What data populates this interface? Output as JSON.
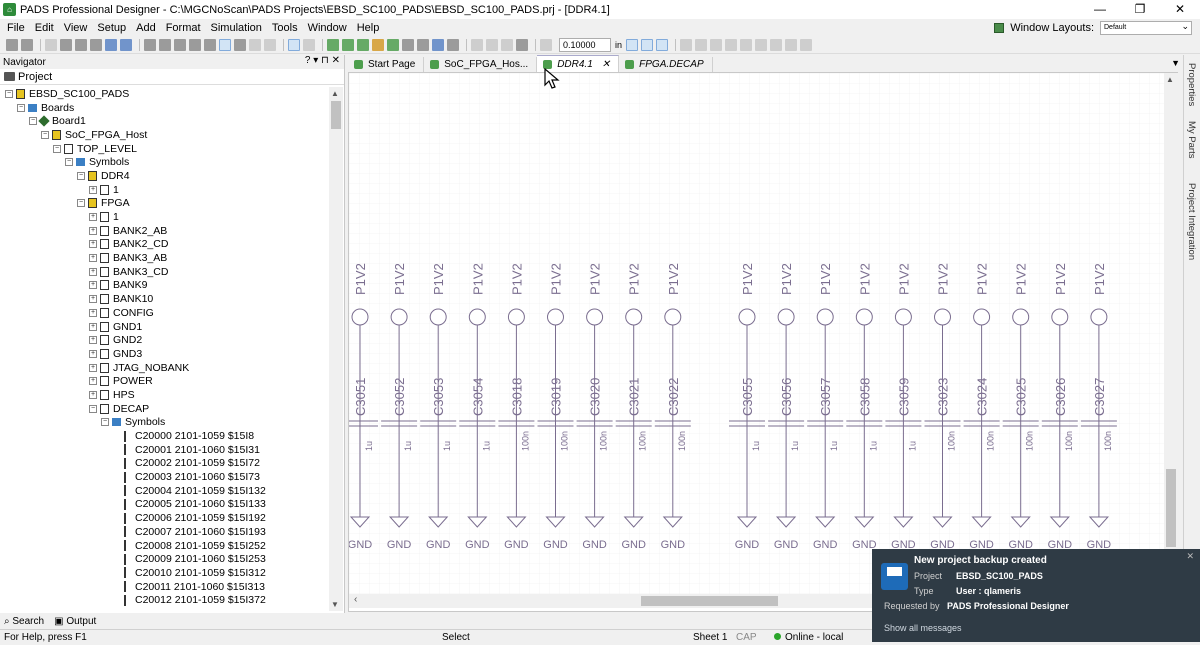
{
  "window": {
    "title": "PADS Professional Designer - C:\\MGCNoScan\\PADS Projects\\EBSD_SC100_PADS\\EBSD_SC100_PADS.prj - [DDR4.1]",
    "min": "—",
    "max": "❐",
    "close": "✕"
  },
  "menu": [
    "File",
    "Edit",
    "View",
    "Setup",
    "Add",
    "Format",
    "Simulation",
    "Tools",
    "Window",
    "Help"
  ],
  "window_layouts": {
    "label": "Window Layouts:",
    "value": "Default"
  },
  "toolbar": {
    "grid_value": "0.10000",
    "unit": "in"
  },
  "navigator": {
    "title": "Navigator",
    "controls": "? ▾ ⊓ ✕",
    "tab": "Project"
  },
  "tree": [
    {
      "label": "EBSD_SC100_PADS",
      "depth": 0,
      "exp": "−",
      "icon": "chip"
    },
    {
      "label": "Boards",
      "depth": 1,
      "exp": "−",
      "icon": "folder"
    },
    {
      "label": "Board1",
      "depth": 2,
      "exp": "−",
      "icon": "board"
    },
    {
      "label": "SoC_FPGA_Host",
      "depth": 3,
      "exp": "−",
      "icon": "chip"
    },
    {
      "label": "TOP_LEVEL",
      "depth": 4,
      "exp": "−",
      "icon": "page"
    },
    {
      "label": "Symbols",
      "depth": 5,
      "exp": "−",
      "icon": "folder"
    },
    {
      "label": "DDR4",
      "depth": 6,
      "exp": "−",
      "icon": "chip"
    },
    {
      "label": "1",
      "depth": 7,
      "exp": "+",
      "icon": "page"
    },
    {
      "label": "FPGA",
      "depth": 6,
      "exp": "−",
      "icon": "chip"
    },
    {
      "label": "1",
      "depth": 7,
      "exp": "+",
      "icon": "page"
    },
    {
      "label": "BANK2_AB",
      "depth": 7,
      "exp": "+",
      "icon": "page"
    },
    {
      "label": "BANK2_CD",
      "depth": 7,
      "exp": "+",
      "icon": "page"
    },
    {
      "label": "BANK3_AB",
      "depth": 7,
      "exp": "+",
      "icon": "page"
    },
    {
      "label": "BANK3_CD",
      "depth": 7,
      "exp": "+",
      "icon": "page"
    },
    {
      "label": "BANK9",
      "depth": 7,
      "exp": "+",
      "icon": "page"
    },
    {
      "label": "BANK10",
      "depth": 7,
      "exp": "+",
      "icon": "page"
    },
    {
      "label": "CONFIG",
      "depth": 7,
      "exp": "+",
      "icon": "page"
    },
    {
      "label": "GND1",
      "depth": 7,
      "exp": "+",
      "icon": "page"
    },
    {
      "label": "GND2",
      "depth": 7,
      "exp": "+",
      "icon": "page"
    },
    {
      "label": "GND3",
      "depth": 7,
      "exp": "+",
      "icon": "page"
    },
    {
      "label": "JTAG_NOBANK",
      "depth": 7,
      "exp": "+",
      "icon": "page"
    },
    {
      "label": "POWER",
      "depth": 7,
      "exp": "+",
      "icon": "page"
    },
    {
      "label": "HPS",
      "depth": 7,
      "exp": "+",
      "icon": "page"
    },
    {
      "label": "DECAP",
      "depth": 7,
      "exp": "−",
      "icon": "page"
    },
    {
      "label": "Symbols",
      "depth": 8,
      "exp": "−",
      "icon": "folder"
    },
    {
      "label": "C20000 2101-1059 $15I8",
      "depth": 9,
      "exp": "",
      "icon": "sym"
    },
    {
      "label": "C20001 2101-1060 $15I31",
      "depth": 9,
      "exp": "",
      "icon": "sym"
    },
    {
      "label": "C20002 2101-1059 $15I72",
      "depth": 9,
      "exp": "",
      "icon": "sym"
    },
    {
      "label": "C20003 2101-1060 $15I73",
      "depth": 9,
      "exp": "",
      "icon": "sym"
    },
    {
      "label": "C20004 2101-1059 $15I132",
      "depth": 9,
      "exp": "",
      "icon": "sym"
    },
    {
      "label": "C20005 2101-1060 $15I133",
      "depth": 9,
      "exp": "",
      "icon": "sym"
    },
    {
      "label": "C20006 2101-1059 $15I192",
      "depth": 9,
      "exp": "",
      "icon": "sym"
    },
    {
      "label": "C20007 2101-1060 $15I193",
      "depth": 9,
      "exp": "",
      "icon": "sym"
    },
    {
      "label": "C20008 2101-1059 $15I252",
      "depth": 9,
      "exp": "",
      "icon": "sym"
    },
    {
      "label": "C20009 2101-1060 $15I253",
      "depth": 9,
      "exp": "",
      "icon": "sym"
    },
    {
      "label": "C20010 2101-1059 $15I312",
      "depth": 9,
      "exp": "",
      "icon": "sym"
    },
    {
      "label": "C20011 2101-1060 $15I313",
      "depth": 9,
      "exp": "",
      "icon": "sym"
    },
    {
      "label": "C20012 2101-1059 $15I372",
      "depth": 9,
      "exp": "",
      "icon": "sym"
    }
  ],
  "bottom_tabs": {
    "search": "Search",
    "output": "Output"
  },
  "doc_tabs": [
    {
      "label": "Start Page",
      "active": false,
      "italic": false
    },
    {
      "label": "SoC_FPGA_Hos...",
      "active": false,
      "italic": false
    },
    {
      "label": "DDR4.1",
      "active": true,
      "italic": true,
      "close": "✕"
    },
    {
      "label": "FPGA.DECAP",
      "active": false,
      "italic": true
    }
  ],
  "schematic": {
    "power_net": "P1V2",
    "ground_net": "GND",
    "group1": [
      {
        "ref": "C3051",
        "value": "1u"
      },
      {
        "ref": "C3052",
        "value": "1u"
      },
      {
        "ref": "C3053",
        "value": "1u"
      },
      {
        "ref": "C3054",
        "value": "1u"
      },
      {
        "ref": "C3018",
        "value": "100n"
      },
      {
        "ref": "C3019",
        "value": "100n"
      },
      {
        "ref": "C3020",
        "value": "100n"
      },
      {
        "ref": "C3021",
        "value": "100n"
      },
      {
        "ref": "C3022",
        "value": "100n"
      }
    ],
    "group2": [
      {
        "ref": "C3055",
        "value": "1u"
      },
      {
        "ref": "C3056",
        "value": "1u"
      },
      {
        "ref": "C3057",
        "value": "1u"
      },
      {
        "ref": "C3058",
        "value": "1u"
      },
      {
        "ref": "C3059",
        "value": "1u"
      },
      {
        "ref": "C3023",
        "value": "100n"
      },
      {
        "ref": "C3024",
        "value": "100n"
      },
      {
        "ref": "C3025",
        "value": "100n"
      },
      {
        "ref": "C3026",
        "value": "100n"
      },
      {
        "ref": "C3027",
        "value": "100n"
      }
    ]
  },
  "right_rail": [
    "Properties",
    "My Parts",
    "Project Integration"
  ],
  "status": {
    "help": "For Help, press F1",
    "mode": "Select",
    "sheet": "Sheet 1",
    "cap": "CAP",
    "online": "Online - local"
  },
  "toast": {
    "title": "New project backup created",
    "project_label": "Project",
    "project_value": "EBSD_SC100_PADS",
    "type_label": "Type",
    "type_value": "User : qlameris",
    "req_label": "Requested by",
    "req_value": "PADS Professional Designer",
    "link": "Show all messages",
    "close": "✕"
  }
}
